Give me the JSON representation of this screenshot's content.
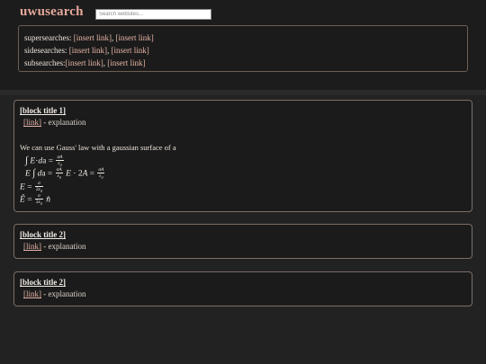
{
  "header": {
    "logo": "uwusearch",
    "search_placeholder": "Search websites..."
  },
  "related": {
    "super_label": "supersearches:",
    "super_links": [
      "[insert link]",
      "[insert link]"
    ],
    "side_label": "sidesearches:",
    "side_links": [
      "[insert link]",
      "[insert link]"
    ],
    "sub_label": "subsearches:",
    "sub_links": [
      "[insert link]",
      "[insert link]"
    ],
    "separator": ","
  },
  "blocks": [
    {
      "title": "[block title 1]",
      "link": "[link]",
      "explanation": "- explanation",
      "body": "We can use Gauss' law with a gaussian surface of a"
    },
    {
      "title": "[block title 2]",
      "link": "[link]",
      "explanation": "- explanation"
    },
    {
      "title": "[block title 2]",
      "link": "[link]",
      "explanation": "- explanation"
    }
  ],
  "colors": {
    "background": "#222222",
    "logo": "#e6a99b",
    "link": "#e7b5a6",
    "border": "#7c6e66"
  }
}
